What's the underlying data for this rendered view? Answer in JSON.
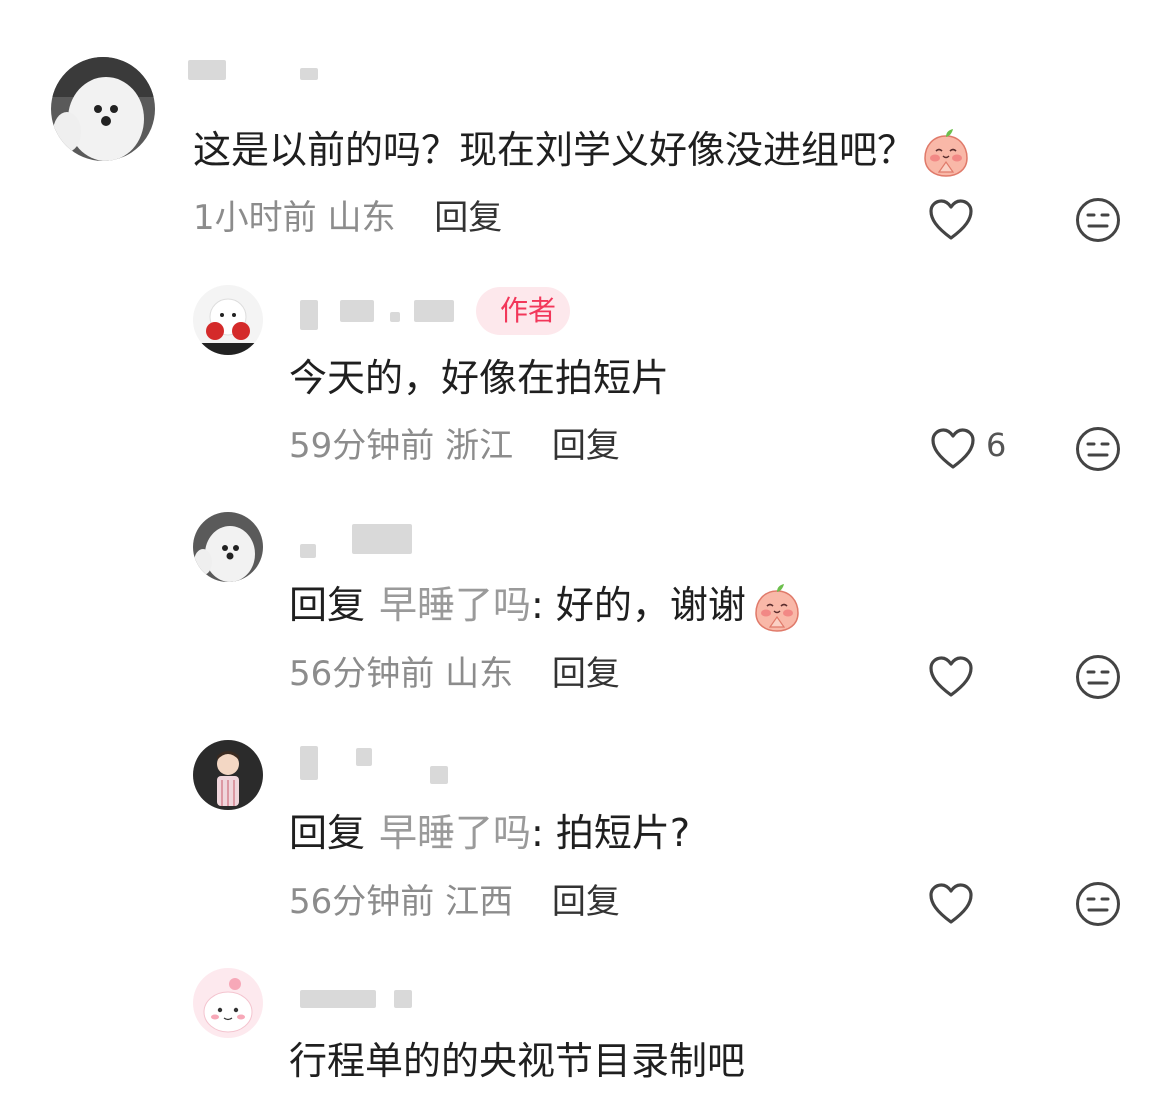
{
  "badge": {
    "author": "作者"
  },
  "comments": [
    {
      "text": "这是以前的吗？现在刘学义好像没进组吧？",
      "time": "1小时前",
      "location": "山东",
      "reply_label": "回复"
    },
    {
      "text": "今天的，好像在拍短片",
      "time": "59分钟前",
      "location": "浙江",
      "reply_label": "回复",
      "likes": "6"
    },
    {
      "reply_prefix": "回复",
      "reply_target": "早睡了吗",
      "text": ": 好的，谢谢",
      "time": "56分钟前",
      "location": "山东",
      "reply_label": "回复"
    },
    {
      "reply_prefix": "回复",
      "reply_target": "早睡了吗",
      "text": ": 拍短片?",
      "time": "56分钟前",
      "location": "江西",
      "reply_label": "回复"
    },
    {
      "text": "行程单的的央视节目录制吧"
    }
  ],
  "icons": {
    "like": "heart-outline-icon",
    "dislike": "neutral-face-icon",
    "emoji": "peach-praying-emoji"
  },
  "colors": {
    "badge_bg": "#fde8ec",
    "badge_text": "#f2375a",
    "meta_text": "#8c8c8c"
  }
}
